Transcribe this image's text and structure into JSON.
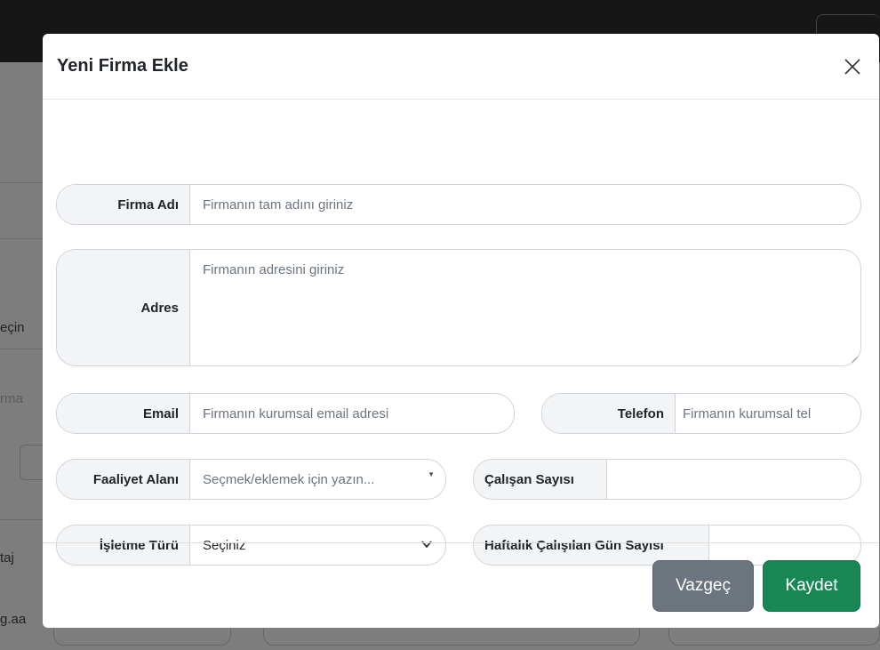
{
  "background": {
    "side_texts": [
      "eçin",
      "rma",
      "taj",
      "g.aa"
    ]
  },
  "modal": {
    "title": "Yeni Firma Ekle",
    "close_icon": "close-icon"
  },
  "form": {
    "firma_adi": {
      "label": "Firma Adı",
      "placeholder": "Firmanın tam adını giriniz"
    },
    "adres": {
      "label": "Adres",
      "placeholder": "Firmanın adresini giriniz"
    },
    "email": {
      "label": "Email",
      "placeholder": "Firmanın kurumsal email adresi"
    },
    "telefon": {
      "label": "Telefon",
      "placeholder": "Firmanın kurumsal tel"
    },
    "faaliyet_alani": {
      "label": "Faaliyet Alanı",
      "placeholder": "Seçmek/eklemek için yazın..."
    },
    "calisan_sayisi": {
      "label": "Çalışan Sayısı",
      "value": ""
    },
    "isletme_turu": {
      "label": "İşletme Türü",
      "selected": "Seçiniz"
    },
    "haftalik_gun": {
      "label": "Haftalık Çalışılan Gün Sayısı",
      "value": ""
    }
  },
  "footer": {
    "cancel_label": "Vazgeç",
    "save_label": "Kaydet"
  },
  "colors": {
    "primary_save": "#198754",
    "secondary_cancel": "#6c757d"
  }
}
